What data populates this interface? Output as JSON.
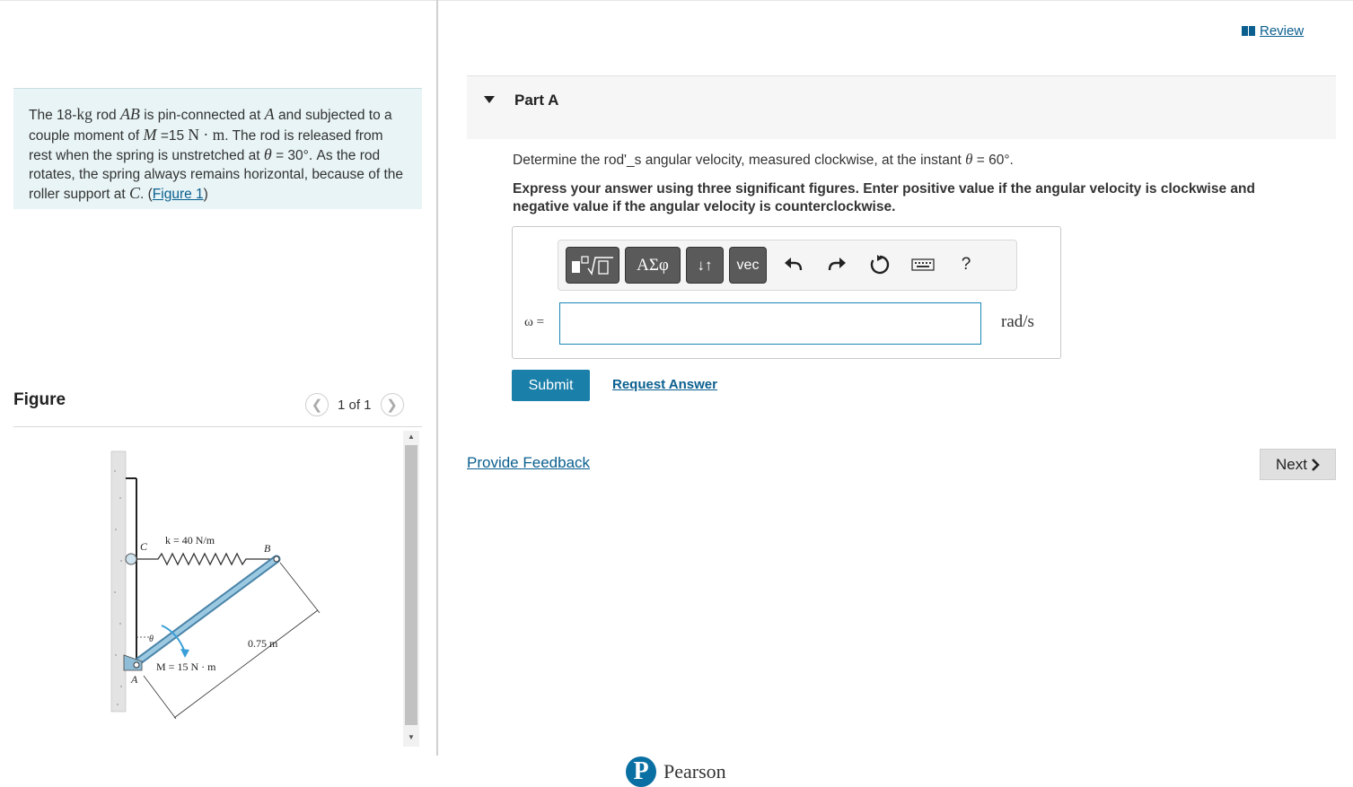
{
  "problem": {
    "t1": "The 18-",
    "kg": "kg",
    "t2": " rod ",
    "AB": "AB",
    "t3": " is pin-connected at ",
    "A": "A",
    "t4": " and subjected to a couple moment of ",
    "M": "M",
    "t5": " =15 ",
    "Nm": "N · m",
    "t6": ". The rod is released from rest when the spring is unstretched at ",
    "theta": "θ",
    "t7": " = 30°. As the rod rotates, the spring always remains horizontal, because of the roller support at ",
    "C": "C",
    "t8": ". (",
    "figure_link": "Figure 1",
    "t9": ")"
  },
  "figure": {
    "title": "Figure",
    "pager": "1 of 1",
    "labels": {
      "spring": "k = 40 N/m",
      "C": "C",
      "B": "B",
      "A": "A",
      "theta": "θ",
      "length": "0.75 m",
      "moment": "M = 15 N · m"
    }
  },
  "review": {
    "label": "Review"
  },
  "part": {
    "title": "Part A",
    "question_pre": "Determine the rod'_s angular velocity, measured clockwise, at the instant ",
    "question_theta": "θ",
    "question_post": " = 60°.",
    "instruction": "Express your answer using three significant figures. Enter positive value if the angular velocity is clockwise and negative value if the angular velocity is counterclockwise."
  },
  "toolbar": {
    "greek": "ΑΣφ",
    "arrows": "↓↑",
    "vec": "vec",
    "help": "?",
    "icons": [
      "templates-icon",
      "greek-icon",
      "arrows-icon",
      "vec-icon",
      "undo-icon",
      "redo-icon",
      "reset-icon",
      "keyboard-icon",
      "help-icon"
    ]
  },
  "answer": {
    "label": "ω =",
    "value": "",
    "unit": "rad/s"
  },
  "buttons": {
    "submit": "Submit",
    "request": "Request Answer",
    "feedback": "Provide Feedback",
    "next": "Next"
  },
  "footer": {
    "brand": "Pearson"
  },
  "colors": {
    "accent": "#1a7fa9",
    "link": "#0a5f8f",
    "problem_bg": "#e8f4f5"
  }
}
